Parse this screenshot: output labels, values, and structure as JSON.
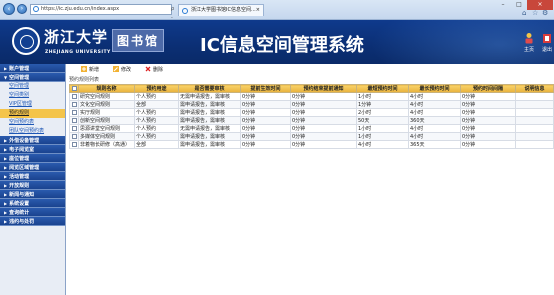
{
  "browser": {
    "url": "https://ic.zju.edu.cn/index.aspx",
    "url_tools": "ρ - ⊖ C ×",
    "tab_title": "浙江大学图书馆IC信息空间...",
    "tab_close": "×",
    "win_min": "–",
    "win_max": "□",
    "win_close": "×"
  },
  "header": {
    "logo_cn": "浙江大学",
    "logo_en": "ZHEJIANG UNIVERSITY",
    "lib_name": "图书馆",
    "system_title": "IC信息空间管理系统",
    "home_label": "主页",
    "exit_label": "退出"
  },
  "sidebar": {
    "sections": [
      {
        "label": "账户管理",
        "expanded": false,
        "items": []
      },
      {
        "label": "空间管理",
        "expanded": true,
        "items": [
          {
            "label": "空间管理",
            "active": false
          },
          {
            "label": "空间类别",
            "active": false
          },
          {
            "label": "VIP区管理",
            "active": false
          },
          {
            "label": "预约规则",
            "active": true
          },
          {
            "label": "空间预约表",
            "active": false
          },
          {
            "label": "团队空间预约表",
            "active": false
          }
        ]
      },
      {
        "label": "外借设备管理",
        "expanded": false,
        "items": []
      },
      {
        "label": "电子阅览室",
        "expanded": false,
        "items": []
      },
      {
        "label": "座位管理",
        "expanded": false,
        "items": []
      },
      {
        "label": "阅览区域管理",
        "expanded": false,
        "items": []
      },
      {
        "label": "活动管理",
        "expanded": false,
        "items": []
      },
      {
        "label": "开放规则",
        "expanded": false,
        "items": []
      },
      {
        "label": "新闻与通知",
        "expanded": false,
        "items": []
      },
      {
        "label": "系统设置",
        "expanded": false,
        "items": []
      },
      {
        "label": "查询统计",
        "expanded": false,
        "items": []
      },
      {
        "label": "违约与处罚",
        "expanded": false,
        "items": []
      }
    ]
  },
  "toolbar": {
    "add_label": "新增",
    "edit_label": "修改",
    "delete_label": "删除"
  },
  "breadcrumb": "预约规则列表",
  "table": {
    "columns": [
      "规则名称",
      "预约用途",
      "是否需要审核",
      "提前生效时间",
      "预约结束提前通知",
      "最短预约时间",
      "最长预约时间",
      "预约时间间隔",
      "说明信息"
    ],
    "rows": [
      [
        "研究空间规则",
        "个人预约",
        "无需申请报告，需审核",
        "0分钟",
        "0分钟",
        "1小时",
        "4小时",
        "0分钟",
        ""
      ],
      [
        "文化空间规则",
        "全部",
        "需申请报告，需审核",
        "0分钟",
        "0分钟",
        "1分钟",
        "4小时",
        "0分钟",
        ""
      ],
      [
        "实厅规则",
        "个人预约",
        "需申请报告，需审核",
        "0分钟",
        "0分钟",
        "2小时",
        "4小时",
        "0分钟",
        ""
      ],
      [
        "创新空间规则",
        "个人预约",
        "需申请报告，需审核",
        "0分钟",
        "0分钟",
        "50天",
        "360天",
        "0分钟",
        ""
      ],
      [
        "思源讲堂空间规则",
        "个人预约",
        "无需申请报告，需审核",
        "0分钟",
        "0分钟",
        "1小时",
        "4小时",
        "0分钟",
        ""
      ],
      [
        "多媒体空间规则",
        "个人预约",
        "需申请报告，需审核",
        "0分钟",
        "0分钟",
        "1小时",
        "4小时",
        "0分钟",
        ""
      ],
      [
        "非着物长研修（高通）",
        "全部",
        "需申请报告，需审核",
        "0分钟",
        "0分钟",
        "4小时",
        "365天",
        "0分钟",
        ""
      ]
    ]
  },
  "colors": {
    "banner": "#0f3a8c",
    "sidebar_header": "#2a5aae",
    "active_item": "#f4c44a",
    "table_header": "#f8d36b"
  }
}
